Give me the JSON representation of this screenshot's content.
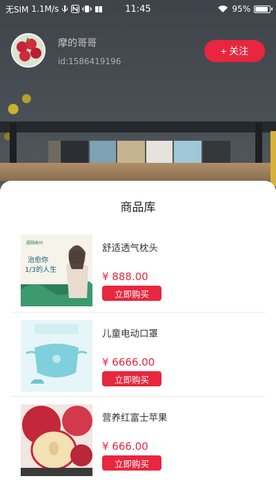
{
  "status_bar": {
    "carrier": "无SIM",
    "speed": "1.1M/s",
    "time": "11:45",
    "battery": "95%",
    "battery_level": 0.95
  },
  "profile": {
    "name": "摩的哥哥",
    "id_text": "id:1586419196",
    "follow_label": "+ 关注"
  },
  "sheet": {
    "title": "商品库"
  },
  "products": [
    {
      "name": "舒适透气枕头",
      "price": "¥ 888.00",
      "buy_label": "立即购买",
      "thumb_text": {
        "brand": "疆颐高州",
        "headline1": "治愈你",
        "headline2": "1/3的人生"
      }
    },
    {
      "name": "儿童电动口罩",
      "price": "¥ 6666.00",
      "buy_label": "立即购买"
    },
    {
      "name": "营养红富士苹果",
      "price": "¥ 666.00",
      "buy_label": "立即购买"
    }
  ],
  "colors": {
    "accent": "#e8263f",
    "text": "#333333",
    "panel": "#ffffff"
  }
}
